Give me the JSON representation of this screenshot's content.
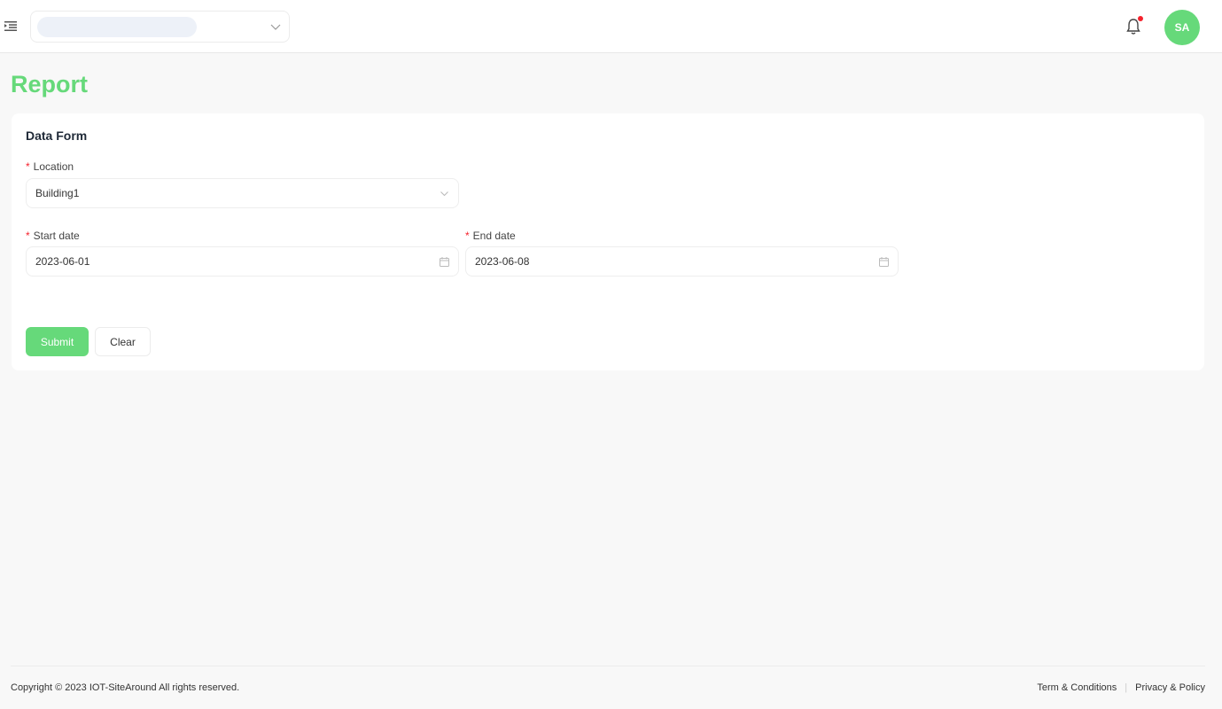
{
  "header": {
    "icons": {
      "menu": "menu-fold-icon",
      "selector_chevron": "chevron-down-icon",
      "notifications": "bell-icon"
    },
    "avatar_initials": "SA",
    "notification_dot_color": "#f5222d"
  },
  "page": {
    "title": "Report"
  },
  "form": {
    "title": "Data Form",
    "required_mark": "*",
    "location": {
      "label": "Location",
      "value": "Building1"
    },
    "start_date": {
      "label": "Start date",
      "value": "2023-06-01"
    },
    "end_date": {
      "label": "End date",
      "value": "2023-06-08"
    },
    "submit_label": "Submit",
    "clear_label": "Clear"
  },
  "footer": {
    "copyright": "Copyright © 2023 IOT-SiteAround All rights reserved.",
    "terms": "Term & Conditions",
    "separator": "|",
    "privacy": "Privacy & Policy"
  },
  "colors": {
    "accent": "#66d97a",
    "required": "#f5222d"
  }
}
